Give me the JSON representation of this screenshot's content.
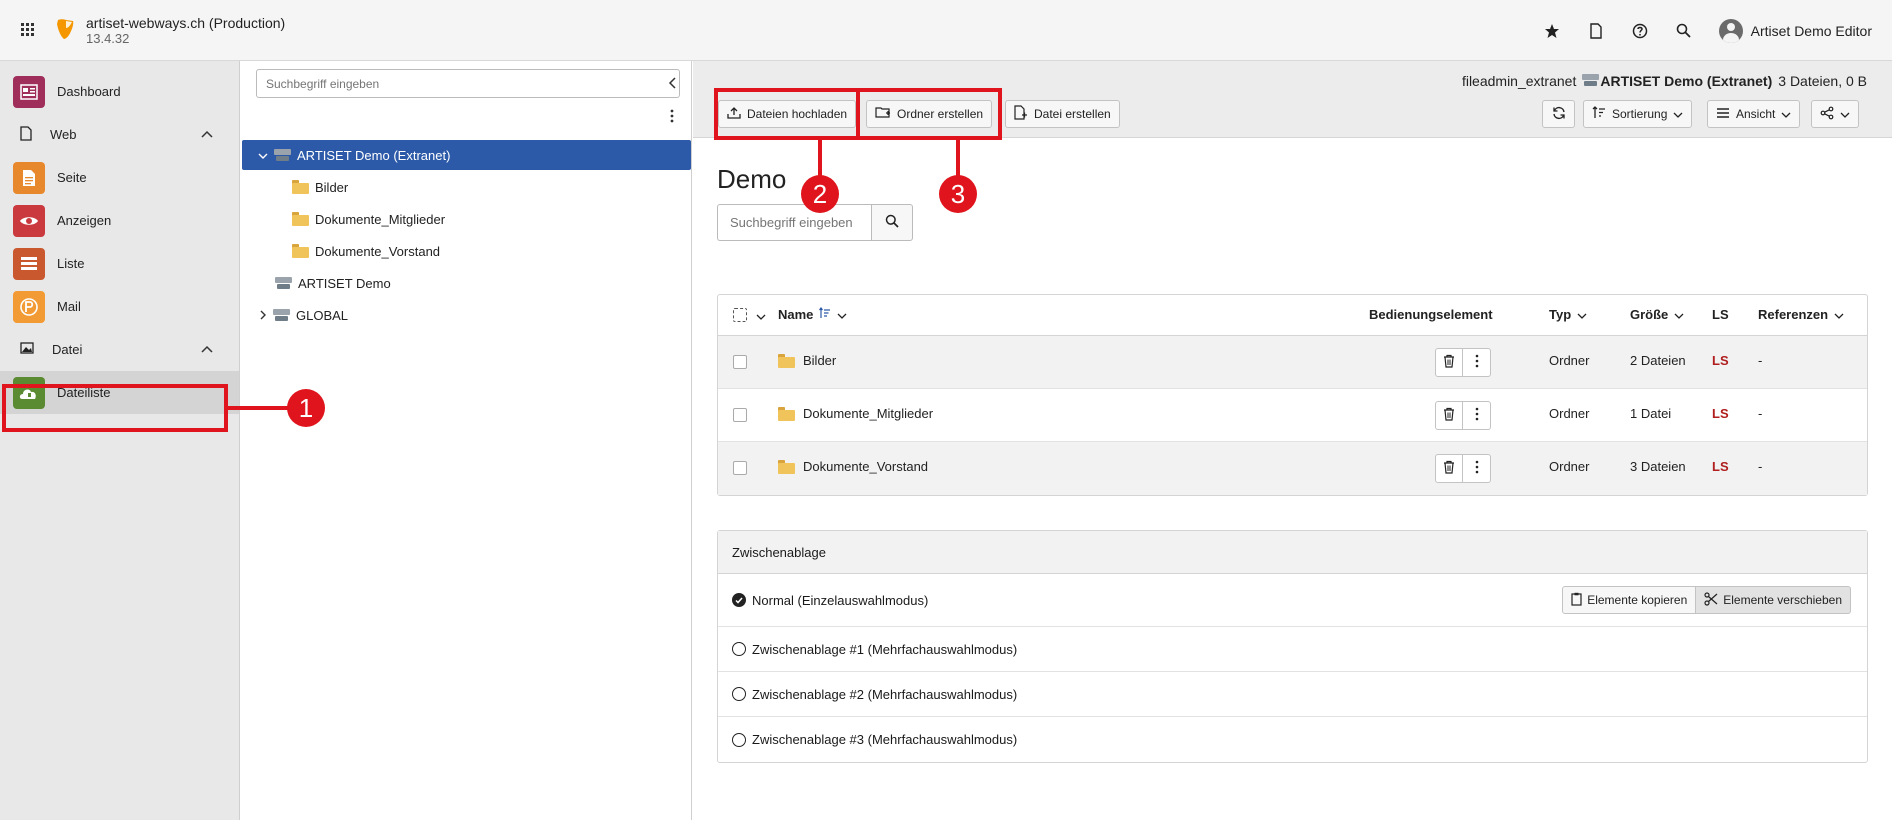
{
  "topbar": {
    "site_name": "artiset-webways.ch (Production)",
    "version": "13.4.32",
    "user_name": "Artiset Demo Editor"
  },
  "modules": {
    "dashboard": "Dashboard",
    "web_group": "Web",
    "seite": "Seite",
    "anzeigen": "Anzeigen",
    "liste": "Liste",
    "mail": "Mail",
    "datei_group": "Datei",
    "dateiliste": "Dateiliste"
  },
  "colors": {
    "dashboard": "#9f2f5a",
    "seite": "#e8882c",
    "anzeigen": "#c9393d",
    "liste": "#c9582e",
    "mail": "#f29a33",
    "dateiliste": "#5a8a31",
    "selected_node": "#2c5aa8",
    "annotation": "#e0141c"
  },
  "tree": {
    "search_placeholder": "Suchbegriff eingeben",
    "nodes": [
      "ARTISET Demo (Extranet)",
      "Bilder",
      "Dokumente_Mitglieder",
      "Dokumente_Vorstand",
      "ARTISET Demo",
      "GLOBAL"
    ]
  },
  "docheader": {
    "path_storage": "fileadmin_extranet",
    "path_folder": "ARTISET Demo (Extranet)",
    "path_info": "3 Dateien, 0 B",
    "upload": "Dateien hochladen",
    "new_folder": "Ordner erstellen",
    "new_file": "Datei erstellen",
    "sort": "Sortierung",
    "view": "Ansicht"
  },
  "main": {
    "title": "Demo",
    "search_placeholder": "Suchbegriff eingeben"
  },
  "table": {
    "headers": {
      "name": "Name",
      "control": "Bedienungselement",
      "type": "Typ",
      "size": "Größe",
      "ls": "LS",
      "refs": "Referenzen"
    },
    "rows": [
      {
        "name": "Bilder",
        "type": "Ordner",
        "size": "2 Dateien",
        "ls": "LS",
        "refs": "-"
      },
      {
        "name": "Dokumente_Mitglieder",
        "type": "Ordner",
        "size": "1 Datei",
        "ls": "LS",
        "refs": "-"
      },
      {
        "name": "Dokumente_Vorstand",
        "type": "Ordner",
        "size": "3 Dateien",
        "ls": "LS",
        "refs": "-"
      }
    ]
  },
  "clipboard": {
    "title": "Zwischenablage",
    "normal": "Normal (Einzelauswahlmodus)",
    "copy": "Elemente kopieren",
    "move": "Elemente verschieben",
    "pad1": "Zwischenablage #1 (Mehrfachauswahlmodus)",
    "pad2": "Zwischenablage #2 (Mehrfachauswahlmodus)",
    "pad3": "Zwischenablage #3 (Mehrfachauswahlmodus)"
  },
  "annotations": {
    "one": "1",
    "two": "2",
    "three": "3"
  }
}
